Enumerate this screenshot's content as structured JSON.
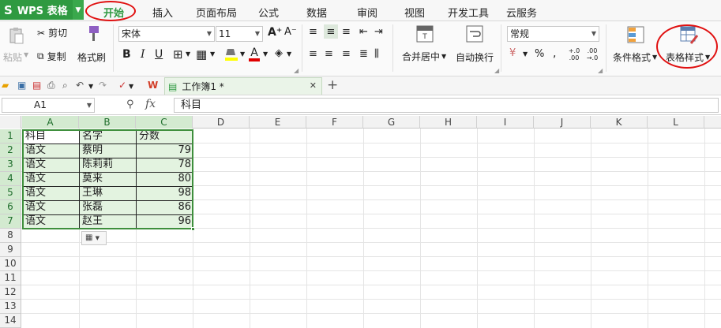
{
  "app": {
    "name": "WPS 表格",
    "logo": "S"
  },
  "menu": {
    "tabs": [
      "开始",
      "插入",
      "页面布局",
      "公式",
      "数据",
      "审阅",
      "视图",
      "开发工具",
      "云服务"
    ],
    "active": "开始"
  },
  "ribbon": {
    "paste_label": "粘贴",
    "cut_label": "剪切",
    "copy_label": "复制",
    "format_painter_label": "格式刷",
    "font_name": "宋体",
    "font_size": "11",
    "merge_label": "合并居中",
    "wrap_label": "自动换行",
    "number_format": "常规",
    "cond_format_label": "条件格式",
    "table_style_label": "表格样式",
    "font_color": "#e00000",
    "fill_color": "#ffff00"
  },
  "quick": {
    "doc_tab": "工作簿1 *"
  },
  "formula_bar": {
    "name_box": "A1",
    "fx": "fx",
    "content": "科目"
  },
  "grid": {
    "columns": [
      "A",
      "B",
      "C",
      "D",
      "E",
      "F",
      "G",
      "H",
      "I",
      "J",
      "K",
      "L"
    ],
    "rows": [
      "1",
      "2",
      "3",
      "4",
      "5",
      "6",
      "7",
      "8",
      "9",
      "10",
      "11",
      "12",
      "13",
      "14"
    ],
    "table": {
      "headers": [
        "科目",
        "名字",
        "分数"
      ],
      "rows": [
        [
          "语文",
          "蔡明",
          "79"
        ],
        [
          "语文",
          "陈莉莉",
          "78"
        ],
        [
          "语文",
          "莫来",
          "80"
        ],
        [
          "语文",
          "王琳",
          "98"
        ],
        [
          "语文",
          "张磊",
          "86"
        ],
        [
          "语文",
          "赵王",
          "96"
        ]
      ]
    }
  },
  "colors": {
    "brand": "#2f9a41",
    "selection": "#e3f3e0",
    "highlight": "#e01010"
  }
}
